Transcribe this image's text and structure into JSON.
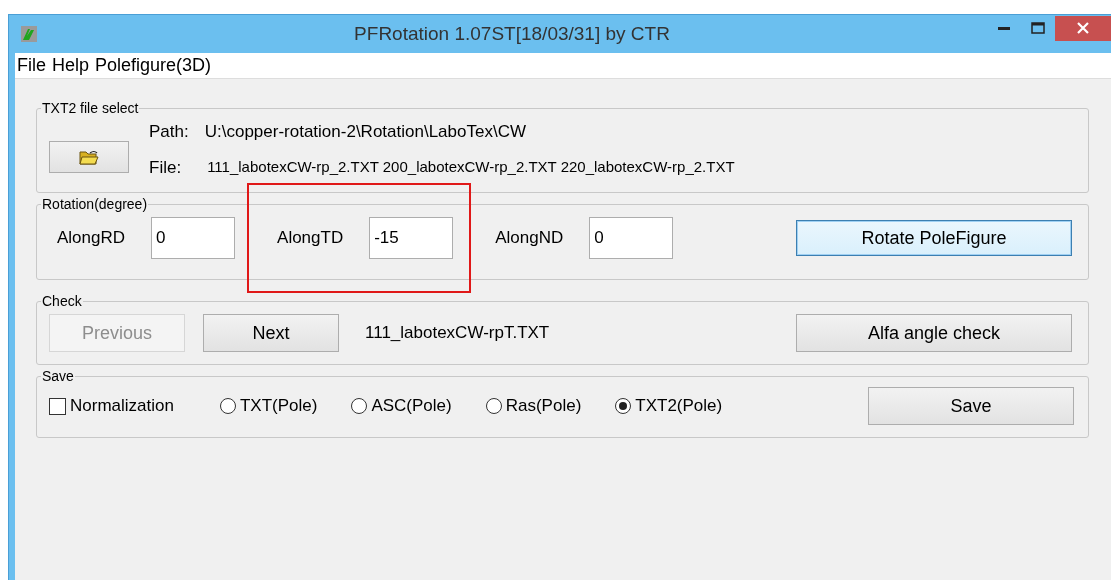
{
  "window": {
    "title": "PFRotation 1.07ST[18/03/31] by CTR"
  },
  "menu": [
    "File",
    "Help",
    "Polefigure(3D)"
  ],
  "file_select": {
    "legend": "TXT2 file select",
    "path_label": "Path:",
    "path": "U:\\copper-rotation-2\\Rotation\\LaboTex\\CW",
    "file_label": "File:",
    "files": "111_labotexCW-rp_2.TXT 200_labotexCW-rp_2.TXT 220_labotexCW-rp_2.TXT"
  },
  "rotation": {
    "legend": "Rotation(degree)",
    "fields": [
      {
        "label": "AlongRD",
        "value": "0",
        "highlighted": false
      },
      {
        "label": "AlongTD",
        "value": "-15",
        "highlighted": true
      },
      {
        "label": "AlongND",
        "value": "0",
        "highlighted": false
      }
    ],
    "button": {
      "label": "Rotate PoleFigure",
      "focused": true
    }
  },
  "check": {
    "legend": "Check",
    "buttons": [
      {
        "label": "Previous",
        "disabled": true
      },
      {
        "label": "Next",
        "disabled": false
      }
    ],
    "file": "111_labotexCW-rpT.TXT",
    "check_button": "Alfa angle check"
  },
  "save": {
    "legend": "Save",
    "normalization": {
      "label": "Normalization",
      "checked": false
    },
    "formats": [
      {
        "label": "TXT(Pole)",
        "selected": false
      },
      {
        "label": "ASC(Pole)",
        "selected": false
      },
      {
        "label": "Ras(Pole)",
        "selected": false
      },
      {
        "label": "TXT2(Pole)",
        "selected": true
      }
    ],
    "button": "Save"
  }
}
